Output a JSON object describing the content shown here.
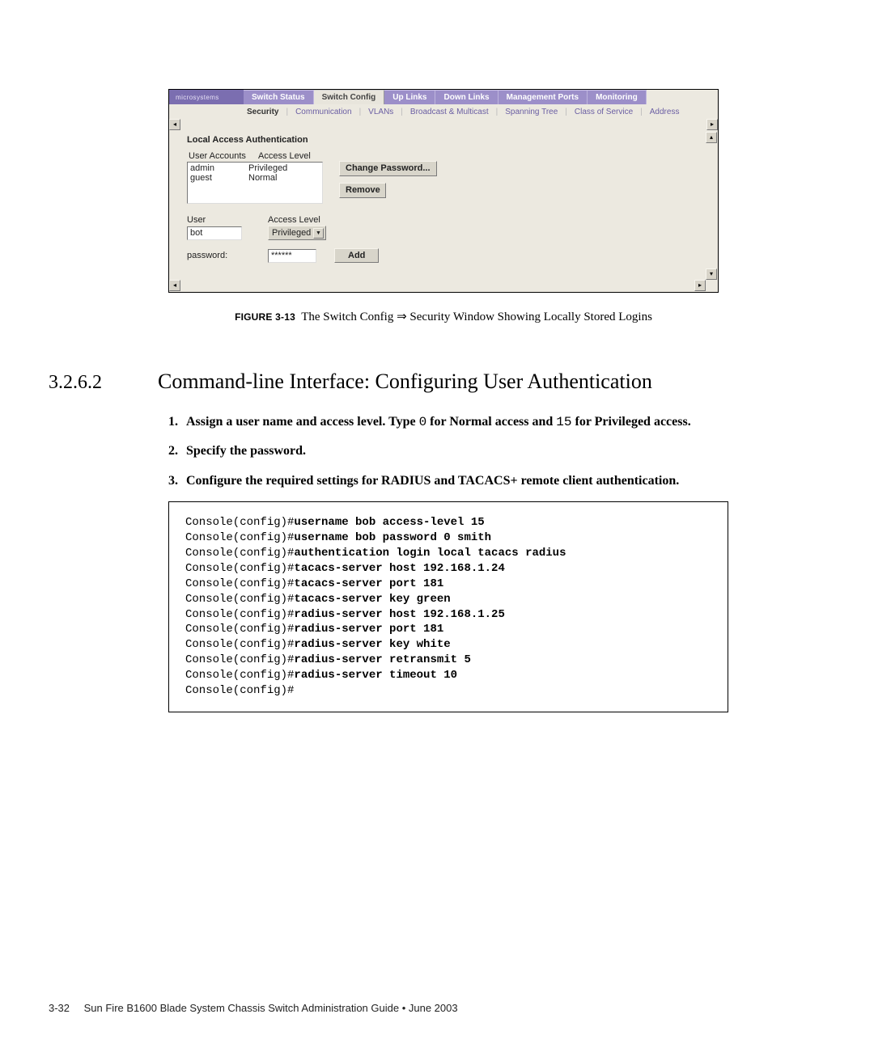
{
  "ui": {
    "brand": "microsystems",
    "tabs": [
      {
        "label": "Switch Status"
      },
      {
        "label": "Switch Config"
      },
      {
        "label": "Up Links"
      },
      {
        "label": "Down Links"
      },
      {
        "label": "Management Ports"
      },
      {
        "label": "Monitoring"
      }
    ],
    "active_tab_index": 1,
    "subtabs": [
      "Security",
      "Communication",
      "VLANs",
      "Broadcast & Multicast",
      "Spanning Tree",
      "Class of Service",
      "Address"
    ],
    "active_subtab_index": 0,
    "section_title": "Local Access Authentication",
    "col_headers": {
      "accounts": "User Accounts",
      "level": "Access Level"
    },
    "accounts": [
      {
        "user": "admin",
        "level": "Privileged"
      },
      {
        "user": "guest",
        "level": "Normal"
      }
    ],
    "buttons": {
      "change_pw": "Change Password...",
      "remove": "Remove",
      "add": "Add"
    },
    "form": {
      "user_label": "User",
      "access_level_label": "Access Level",
      "user_value": "bot",
      "access_level_value": "Privileged",
      "password_label": "password:",
      "password_value": "******"
    }
  },
  "caption": {
    "figure_number": "FIGURE 3-13",
    "text": "The Switch Config ⇒ Security Window Showing Locally Stored Logins"
  },
  "heading": {
    "number": "3.2.6.2",
    "title": "Command-line Interface: Configuring User Authentication"
  },
  "steps": [
    {
      "n": "1.",
      "pre": "Assign a user name and access level. Type ",
      "code1": "0",
      "mid": " for Normal access and ",
      "code2": "15",
      "post": " for Privileged access."
    },
    {
      "n": "2.",
      "pre": "Specify the password."
    },
    {
      "n": "3.",
      "pre": "Configure the required settings for RADIUS and TACACS+ remote client authentication."
    }
  ],
  "console": {
    "prompt": "Console(config)#",
    "lines": [
      "username bob access-level 15",
      "username bob password 0 smith",
      "authentication login local tacacs radius",
      "tacacs-server host 192.168.1.24",
      "tacacs-server port 181",
      "tacacs-server key green",
      "radius-server host 192.168.1.25",
      "radius-server port 181",
      "radius-server key white",
      "radius-server retransmit 5",
      "radius-server timeout 10"
    ]
  },
  "footer": {
    "page": "3-32",
    "title": "Sun Fire B1600 Blade System Chassis Switch Administration Guide • June 2003"
  }
}
